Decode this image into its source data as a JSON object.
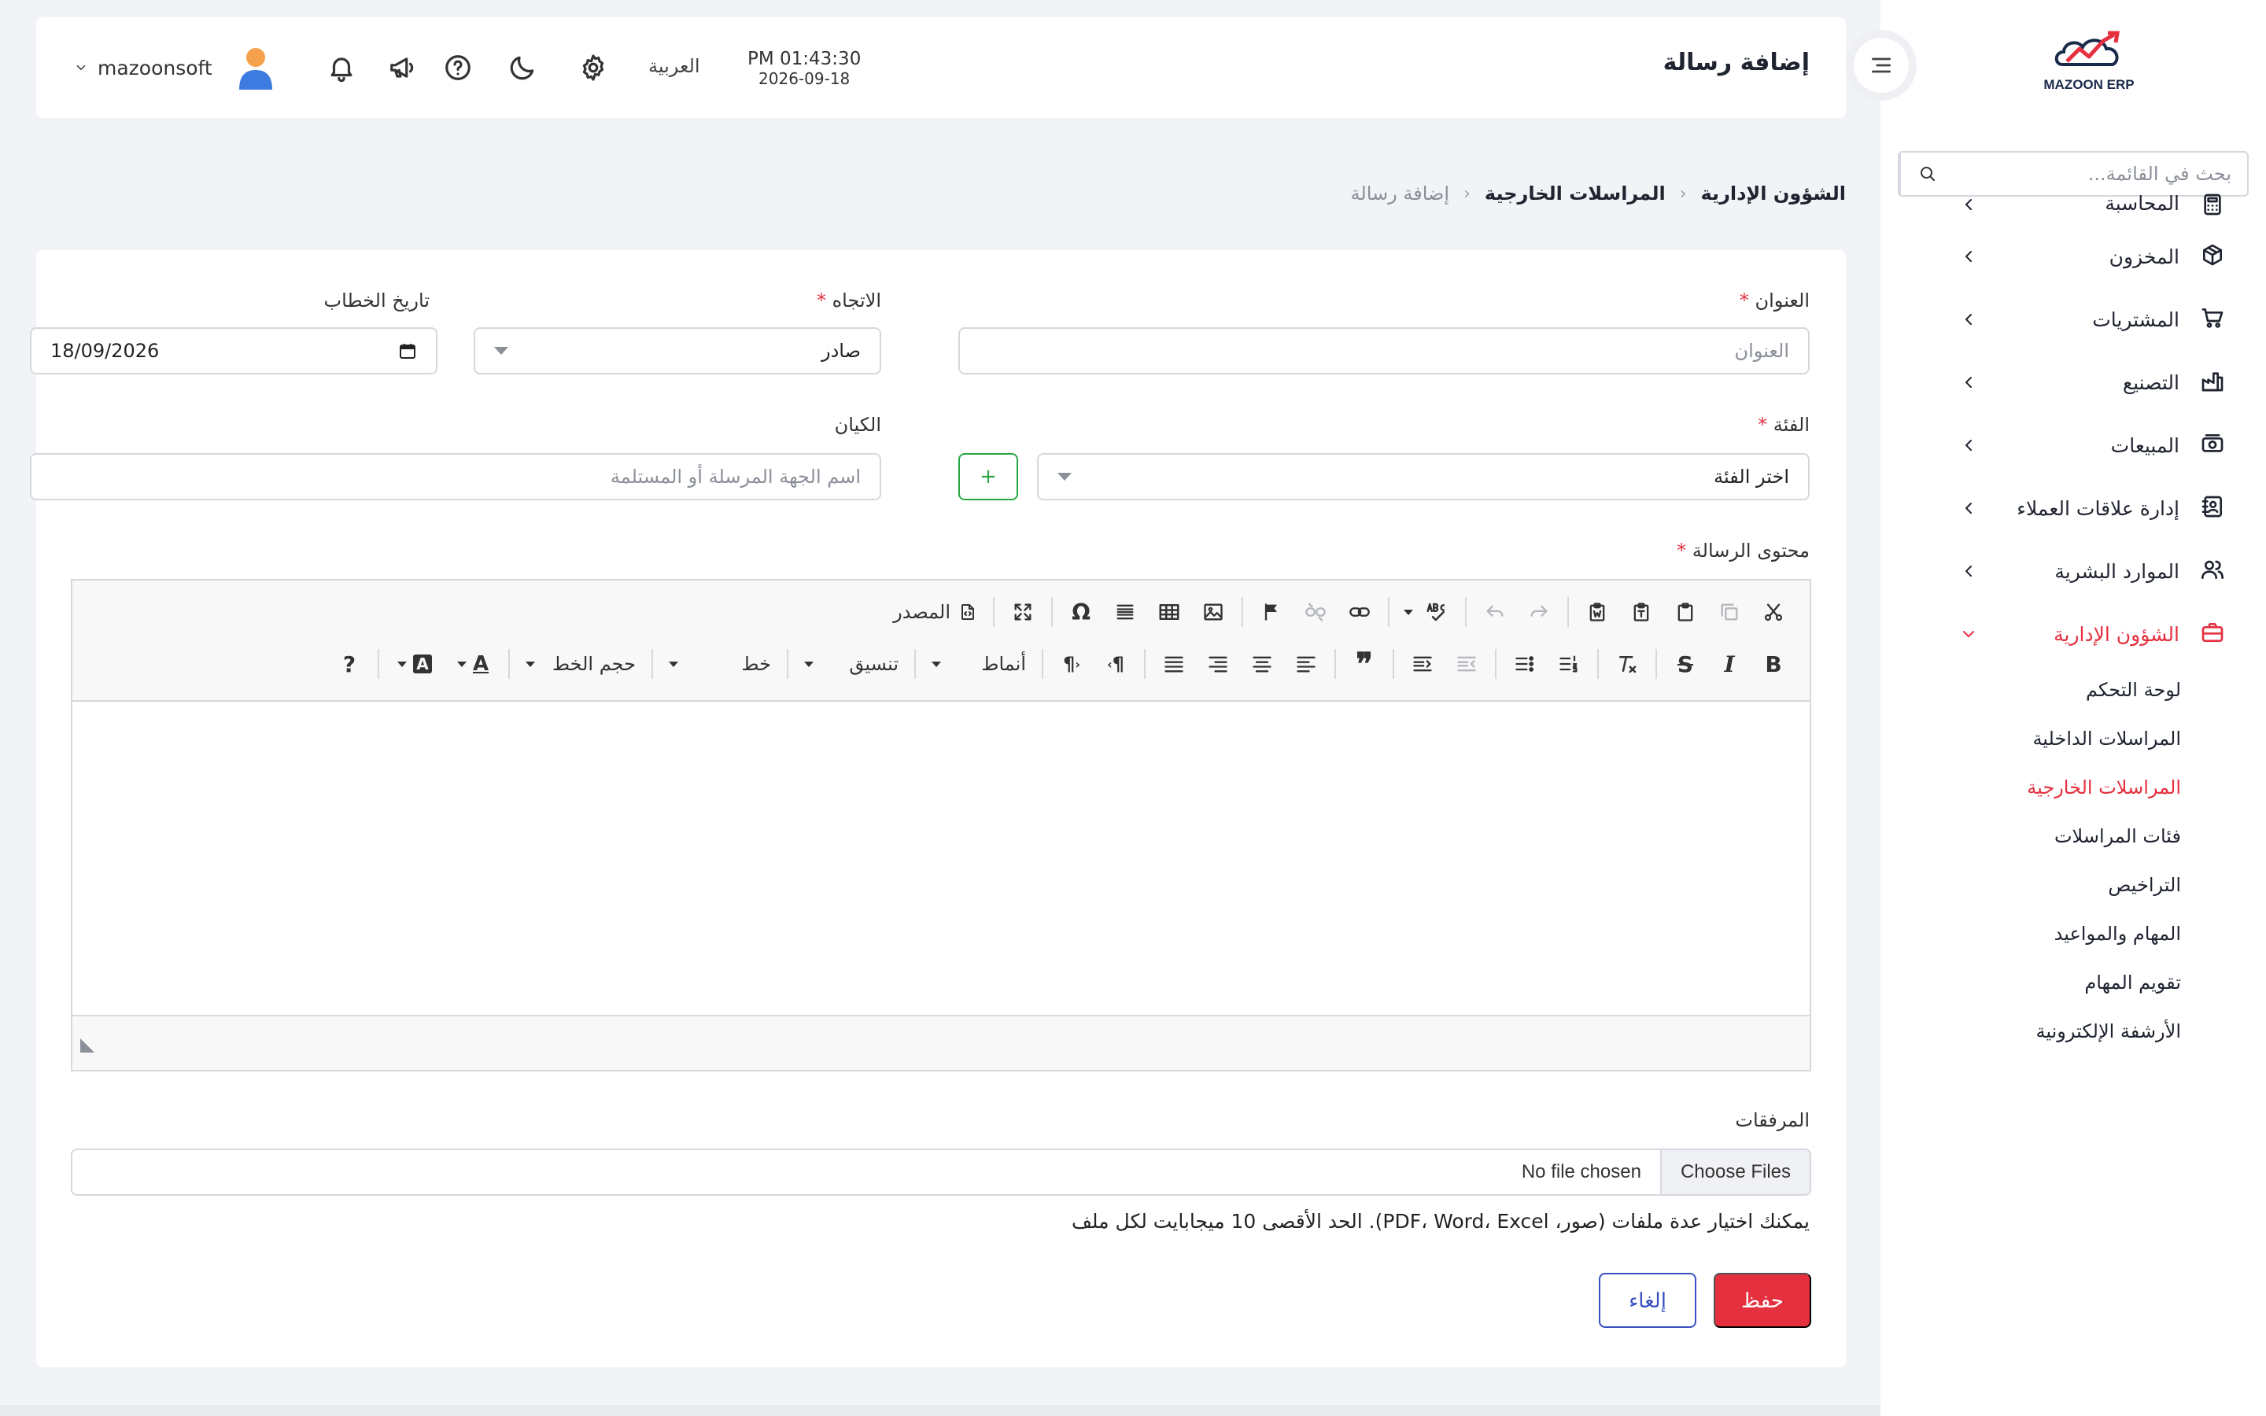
{
  "brand": {
    "name": "MAZOON ERP",
    "colors": {
      "primary": "#e5303f",
      "secondary": "#3a50c0",
      "success": "#28a745"
    }
  },
  "sidebar": {
    "search_placeholder": "بحث في القائمة...",
    "items": [
      {
        "label": "المحاسبة",
        "icon": "calculator-icon"
      },
      {
        "label": "المخزون",
        "icon": "box-icon"
      },
      {
        "label": "المشتريات",
        "icon": "cart-icon"
      },
      {
        "label": "التصنيع",
        "icon": "factory-icon"
      },
      {
        "label": "المبيعات",
        "icon": "cash-icon"
      },
      {
        "label": "إدارة علاقات العملاء",
        "icon": "contacts-icon"
      },
      {
        "label": "الموارد البشرية",
        "icon": "users-icon"
      },
      {
        "label": "الشؤون الإدارية",
        "icon": "briefcase-icon",
        "active": true
      }
    ],
    "submenu": [
      {
        "label": "لوحة التحكم"
      },
      {
        "label": "المراسلات الداخلية"
      },
      {
        "label": "المراسلات الخارجية",
        "active": true
      },
      {
        "label": "فئات المراسلات"
      },
      {
        "label": "التراخيص"
      },
      {
        "label": "المهام والمواعيد"
      },
      {
        "label": "تقويم المهام"
      },
      {
        "label": "الأرشفة الإلكترونية"
      }
    ]
  },
  "topbar": {
    "title": "إضافة رسالة",
    "time": "PM 01:43:30",
    "date": "2026-09-18",
    "language": "العربية",
    "username": "mazoonsoft"
  },
  "breadcrumb": [
    "الشؤون الإدارية",
    "المراسلات الخارجية",
    "إضافة رسالة"
  ],
  "form": {
    "subject": {
      "label": "العنوان",
      "placeholder": "العنوان",
      "required": true
    },
    "direction": {
      "label": "الاتجاه",
      "value": "صادر",
      "required": true
    },
    "letter_date": {
      "label": "تاريخ الخطاب",
      "value": "18/09/2026"
    },
    "category": {
      "label": "الفئة",
      "placeholder": "اختر الفئة",
      "required": true
    },
    "entity": {
      "label": "الكيان",
      "placeholder": "اسم الجهة المرسلة أو المستلمة"
    },
    "add_button": "+",
    "content": {
      "label": "محتوى الرسالة",
      "required": true
    },
    "editor": {
      "source_label": "المصدر",
      "styles_label": "أنماط",
      "format_label": "تنسيق",
      "font_label": "خط",
      "size_label": "حجم الخط",
      "bold": "B",
      "italic": "I",
      "strike": "S",
      "omega": "Ω",
      "help": "?",
      "text_color": "A",
      "bg_color": "A",
      "quote": "❞",
      "ltr": "¶",
      "rtl": "¶"
    },
    "attachments": {
      "label": "المرفقات",
      "button": "Choose Files",
      "status": "No file chosen",
      "hint": "يمكنك اختيار عدة ملفات (صور، PDF، Word، Excel). الحد الأقصى 10 ميجابايت لكل ملف"
    },
    "save": "حفظ",
    "cancel": "إلغاء",
    "required_mark": "*"
  }
}
